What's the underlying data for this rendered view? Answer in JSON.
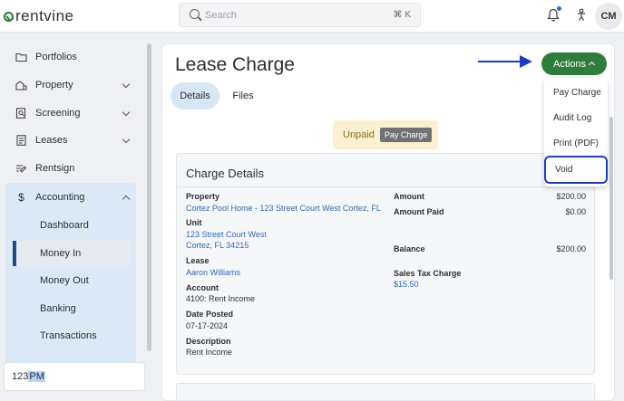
{
  "app": {
    "logo_text": "rentvine",
    "accent_color": "#2e7d3a"
  },
  "search": {
    "placeholder": "Search",
    "shortcut": "⌘ K"
  },
  "header": {
    "avatar_initials": "CM"
  },
  "sidebar": {
    "items": [
      {
        "label": "Portfolios",
        "icon": "folder-icon"
      },
      {
        "label": "Property",
        "icon": "property-icon"
      },
      {
        "label": "Screening",
        "icon": "screening-icon"
      },
      {
        "label": "Leases",
        "icon": "lease-icon"
      },
      {
        "label": "Rentsign",
        "icon": "sign-icon"
      },
      {
        "label": "Accounting",
        "icon": "dollar-icon"
      }
    ],
    "accounting_sub": [
      {
        "label": "Dashboard"
      },
      {
        "label": "Money In",
        "active": true
      },
      {
        "label": "Money Out"
      },
      {
        "label": "Banking"
      },
      {
        "label": "Transactions"
      }
    ],
    "time_prefix": "123 ",
    "time_selected": "PM"
  },
  "page": {
    "title": "Lease Charge",
    "tabs": [
      {
        "label": "Details",
        "active": true
      },
      {
        "label": "Files"
      }
    ],
    "status_label": "Unpaid",
    "status_button": "Pay Charge"
  },
  "actions": {
    "button_label": "Actions",
    "menu": [
      {
        "label": "Pay Charge"
      },
      {
        "label": "Audit Log"
      },
      {
        "label": "Print (PDF)"
      },
      {
        "label": "Void"
      }
    ]
  },
  "charge_details": {
    "title": "Charge Details",
    "property_label": "Property",
    "property_value": "Cortez Pool Home - 123 Street Court West Cortez, FL",
    "unit_label": "Unit",
    "unit_line1": "123 Street Court West",
    "unit_line2": "Cortez, FL 34215",
    "lease_label": "Lease",
    "lease_value": "Aaron Williams",
    "account_label": "Account",
    "account_value": "4100: Rent Income",
    "date_label": "Date Posted",
    "date_value": "07-17-2024",
    "description_label": "Description",
    "description_value": "Rent Income",
    "amount_label": "Amount",
    "amount_value": "$200.00",
    "amount_paid_label": "Amount Paid",
    "amount_paid_value": "$0.00",
    "balance_label": "Balance",
    "balance_value": "$200.00",
    "sales_tax_label": "Sales Tax Charge",
    "sales_tax_value": "$15.50"
  }
}
